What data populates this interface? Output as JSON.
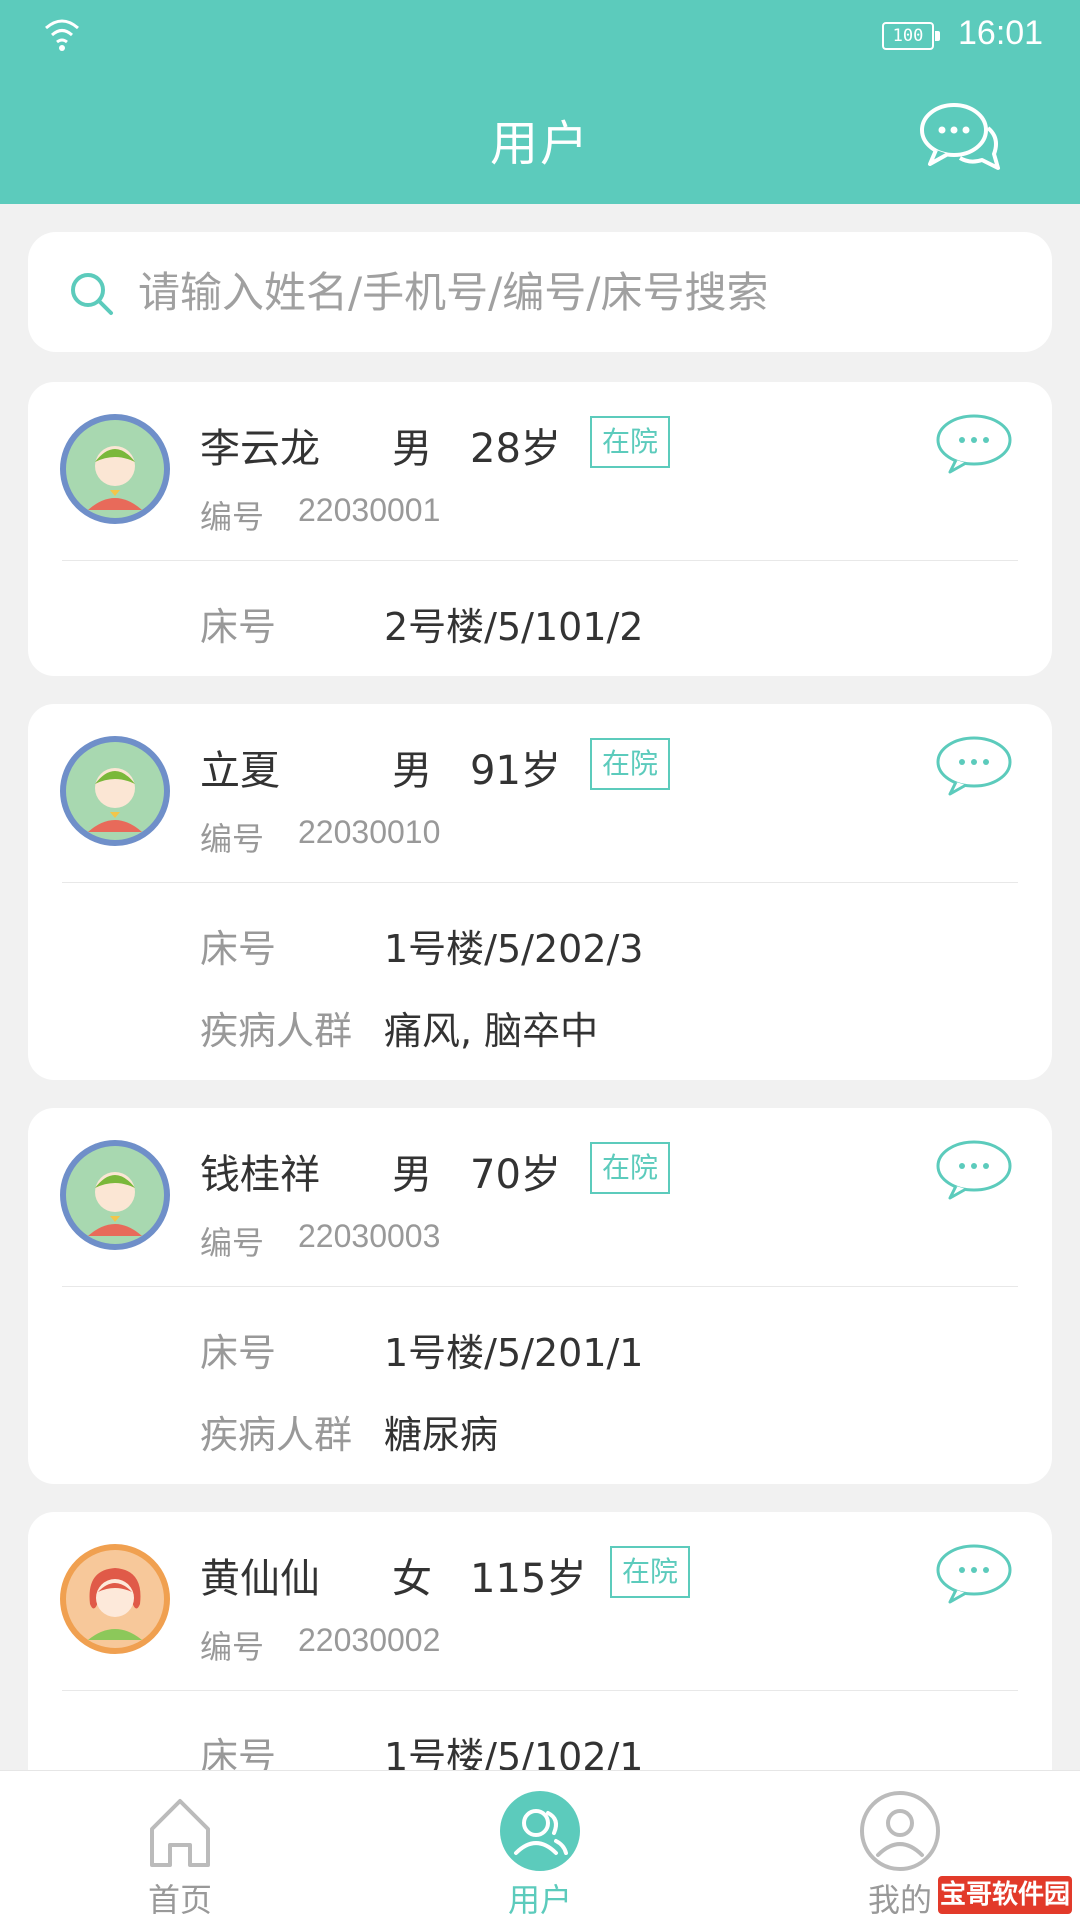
{
  "status_bar": {
    "battery": "100",
    "time": "16:01"
  },
  "header": {
    "title": "用户"
  },
  "search": {
    "placeholder": "请输入姓名/手机号/编号/床号搜索"
  },
  "users": [
    {
      "name": "李云龙",
      "gender": "男",
      "age": "28岁",
      "status": "在院",
      "id_label": "编号",
      "id": "22030001",
      "bed_label": "床号",
      "bed": "2号楼/5/101/2"
    },
    {
      "name": "立夏",
      "gender": "男",
      "age": "91岁",
      "status": "在院",
      "id_label": "编号",
      "id": "22030010",
      "bed_label": "床号",
      "bed": "1号楼/5/202/3",
      "disease_label": "疾病人群",
      "disease": "痛风, 脑卒中"
    },
    {
      "name": "钱桂祥",
      "gender": "男",
      "age": "70岁",
      "status": "在院",
      "id_label": "编号",
      "id": "22030003",
      "bed_label": "床号",
      "bed": "1号楼/5/201/1",
      "disease_label": "疾病人群",
      "disease": "糖尿病"
    },
    {
      "name": "黄仙仙",
      "gender": "女",
      "age": "115岁",
      "status": "在院",
      "id_label": "编号",
      "id": "22030002",
      "bed_label": "床号",
      "bed": "1号楼/5/102/1"
    }
  ],
  "bottom_nav": [
    {
      "label": "首页",
      "icon": "home-icon",
      "active": false
    },
    {
      "label": "用户",
      "icon": "users-icon",
      "active": true
    },
    {
      "label": "我的",
      "icon": "profile-icon",
      "active": false
    }
  ],
  "watermark": "宝哥软件园",
  "colors": {
    "accent": "#5ccbbc",
    "avatar_male_ring": "#6f8fc9",
    "avatar_female_ring": "#f0a050"
  }
}
